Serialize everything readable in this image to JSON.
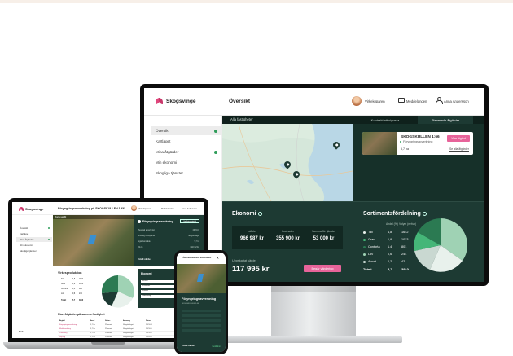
{
  "brand": {
    "name": "Skogsvinge",
    "accent": "#e0467c",
    "dark_green": "#1d3a33",
    "button_pink": "#e7649a"
  },
  "desktop": {
    "header": {
      "page_title": "Översikt",
      "user_name": "Virkeköparen",
      "messages_label": "Meddelanden",
      "account_name": "Anna Andersson"
    },
    "sidebar": [
      {
        "label": "Översikt",
        "active": true,
        "dot": true
      },
      {
        "label": "Kartläget",
        "active": false,
        "dot": false
      },
      {
        "label": "Mina åtgärder",
        "active": false,
        "dot": true
      },
      {
        "label": "Min ekonomi",
        "active": false,
        "dot": false
      },
      {
        "label": "Skogliga tjänster",
        "active": false,
        "dot": false
      }
    ],
    "map": {
      "bar_label": "Alla fastigheter"
    },
    "tabs": [
      {
        "label": "Kontrakt att signera",
        "active": false
      },
      {
        "label": "Planerade åtgärder",
        "active": true
      }
    ],
    "card": {
      "title": "SKOGSKULLEN 1:66",
      "subtitle": "Föryngringsavverkning",
      "area": "5,7 ha",
      "button_label": "Visa åtgärd",
      "link_label": "Se alla åtgärder"
    },
    "economy": {
      "title": "Ekonomi",
      "columns": [
        {
          "label": "Intäkter",
          "value": "966 987 kr"
        },
        {
          "label": "Kostnader",
          "value": "355 900 kr"
        },
        {
          "label": "Summa för tjänster",
          "value": "53 000 kr"
        }
      ],
      "sub_label": "Uppskattat värde",
      "big_value": "117 995 kr",
      "button_label": "Begär värdering"
    },
    "assortment": {
      "title": "Sortimentsfördelning",
      "headers": [
        "Andel (%)",
        "Volym (m³fub)"
      ],
      "rows": [
        {
          "name": "Tall",
          "v1": "4,8",
          "v2": "1642",
          "color": "#e8f1ec"
        },
        {
          "name": "Gran",
          "v1": "1,9",
          "v2": "1023",
          "color": "#45b678"
        },
        {
          "name": "Contorta",
          "v1": "1,4",
          "v2": "801",
          "color": "#2b7a52"
        },
        {
          "name": "Löv",
          "v1": "0,6",
          "v2": "244",
          "color": "#9fd2b4"
        },
        {
          "name": "Annat",
          "v1": "0,2",
          "v2": "42",
          "color": "#c9d8d1"
        }
      ],
      "total_label": "Totalt",
      "total_v1": "5,7",
      "total_v2": "3910"
    }
  },
  "laptop": {
    "header": {
      "title": "Föryngringsavverkning på SKOGSKULLEN 1:66",
      "user_name": "Virkeköparen",
      "messages_label": "Meddelanden",
      "account_name": "Anna Andersson"
    },
    "sidebar": [
      {
        "label": "Översikt",
        "active": false,
        "dot": true
      },
      {
        "label": "Kartläget",
        "active": false,
        "dot": false
      },
      {
        "label": "Mina åtgärder",
        "active": true,
        "dot": true
      },
      {
        "label": "Min ekonomi",
        "active": false,
        "dot": false
      },
      {
        "label": "Skogliga tjänster",
        "active": false,
        "dot": false
      }
    ],
    "footer": "Sök",
    "photo_bar": "Karta satellit",
    "panel": {
      "title": "Föryngringsavverkning",
      "button_label": "Godkänn åtgärd",
      "rows": [
        {
          "l": "Planerad avverkning",
          "r": "2023-03"
        },
        {
          "l": "Ansvarig entreprenör",
          "r": "Skogsbolaget"
        },
        {
          "l": "Åtgärdsområde",
          "r": "5,7 ha"
        },
        {
          "l": "Volym",
          "r": "3910 m³fub"
        }
      ],
      "strong": "Totalt värde"
    },
    "chart_title": "Virkesproduktion",
    "srows": [
      {
        "n": "Tall",
        "v1": "4,8",
        "v2": "1642"
      },
      {
        "n": "Gran",
        "v1": "1,9",
        "v2": "1023"
      },
      {
        "n": "Contorta",
        "v1": "1,4",
        "v2": "801"
      },
      {
        "n": "Löv",
        "v1": "0,6",
        "v2": "244"
      },
      {
        "n": "Totalt",
        "v1": "5,7",
        "v2": "3910"
      }
    ],
    "eco_title": "Ekonomi",
    "eco_lines": [
      "Intäkter",
      "Kostnader",
      "Summa",
      "Utbetalning"
    ],
    "table_title": "Plan åtgärder på samma fastighet",
    "table_headers": [
      "Åtgärd",
      "Areal",
      "Status",
      "Ansvarig",
      "Datum",
      "Förlopp"
    ],
    "table_rows": [
      [
        "Föryngringsavverkning",
        "5,7 ha",
        "Planerad",
        "Skogsbolaget",
        "2023-03",
        ""
      ],
      [
        "Markberedning",
        "5,7 ha",
        "Planerad",
        "Skogsbolaget",
        "2023-05",
        ""
      ],
      [
        "Plantering",
        "5,7 ha",
        "Planerad",
        "Skogsbolaget",
        "2023-06",
        ""
      ],
      [
        "Röjning",
        "2,1 ha",
        "Planerad",
        "Skogsbolaget",
        "2024-08",
        ""
      ],
      [
        "Gallring",
        "3,4 ha",
        "Planerad",
        "Skogsbolaget",
        "2025-09",
        ""
      ]
    ]
  },
  "phone": {
    "header": "FÖRYNGRINGSAVVERKNING",
    "title": "Föryngringsavverkning",
    "subtitle": "SKOGSKULLEN 1:66",
    "footer": "Totalt värde",
    "footer_link": "Godkänn"
  }
}
